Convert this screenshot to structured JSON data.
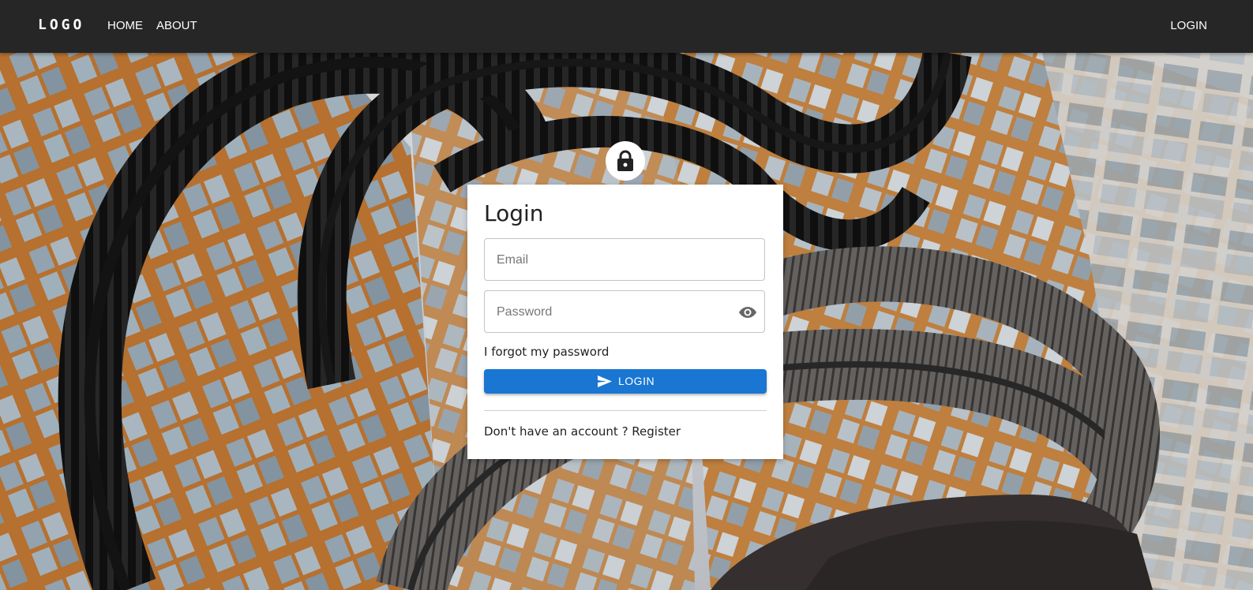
{
  "navbar": {
    "logo": "LOGO",
    "links": [
      "HOME",
      "ABOUT"
    ],
    "login": "LOGIN",
    "background": "#262626"
  },
  "hero": {
    "background_image": "spiral-staircase-courtyard-photo"
  },
  "card": {
    "icon": "lock-icon",
    "title": "Login",
    "email_placeholder": "Email",
    "password_placeholder": "Password",
    "password_toggle_icon": "eye-icon",
    "forgot_password": "I forgot my password",
    "login_button": {
      "label": "LOGIN",
      "icon": "send-icon",
      "color": "#1976d2"
    },
    "register_text": "Don't have an account ? Register"
  }
}
